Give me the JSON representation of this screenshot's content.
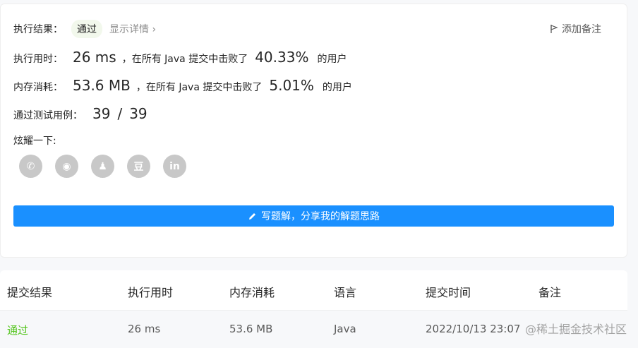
{
  "result": {
    "label": "执行结果：",
    "status": "通过",
    "detail_link": "显示详情",
    "detail_chevron": "›",
    "add_note": "添加备注"
  },
  "runtime": {
    "label": "执行用时：",
    "value": "26 ms",
    "beat_text": "，在所有 Java 提交中击败了",
    "percent": "40.33%",
    "suffix": "的用户"
  },
  "memory": {
    "label": "内存消耗：",
    "value": "53.6 MB",
    "beat_text": "，在所有 Java 提交中击败了",
    "percent": "5.01%",
    "suffix": "的用户"
  },
  "tests": {
    "label": "通过测试用例：",
    "passed": "39",
    "sep": "/",
    "total": "39"
  },
  "share": {
    "label": "炫耀一下:",
    "icons": [
      "wechat-icon",
      "weibo-icon",
      "qq-icon",
      "douban-icon",
      "linkedin-icon"
    ],
    "glyphs": [
      "✆",
      "◉",
      "♟",
      "豆",
      "in"
    ]
  },
  "write_button": "写题解，分享我的解题思路",
  "table": {
    "headers": [
      "提交结果",
      "执行用时",
      "内存消耗",
      "语言",
      "提交时间",
      "备注"
    ],
    "rows": [
      [
        "通过",
        "26 ms",
        "53.6 MB",
        "Java",
        "2022/10/13 23:07",
        ""
      ]
    ]
  },
  "watermark": "@稀土掘金技术社区",
  "colors": {
    "accent": "#1a90ff",
    "success": "#52c41a",
    "icon_gray": "#c8c8c8"
  }
}
